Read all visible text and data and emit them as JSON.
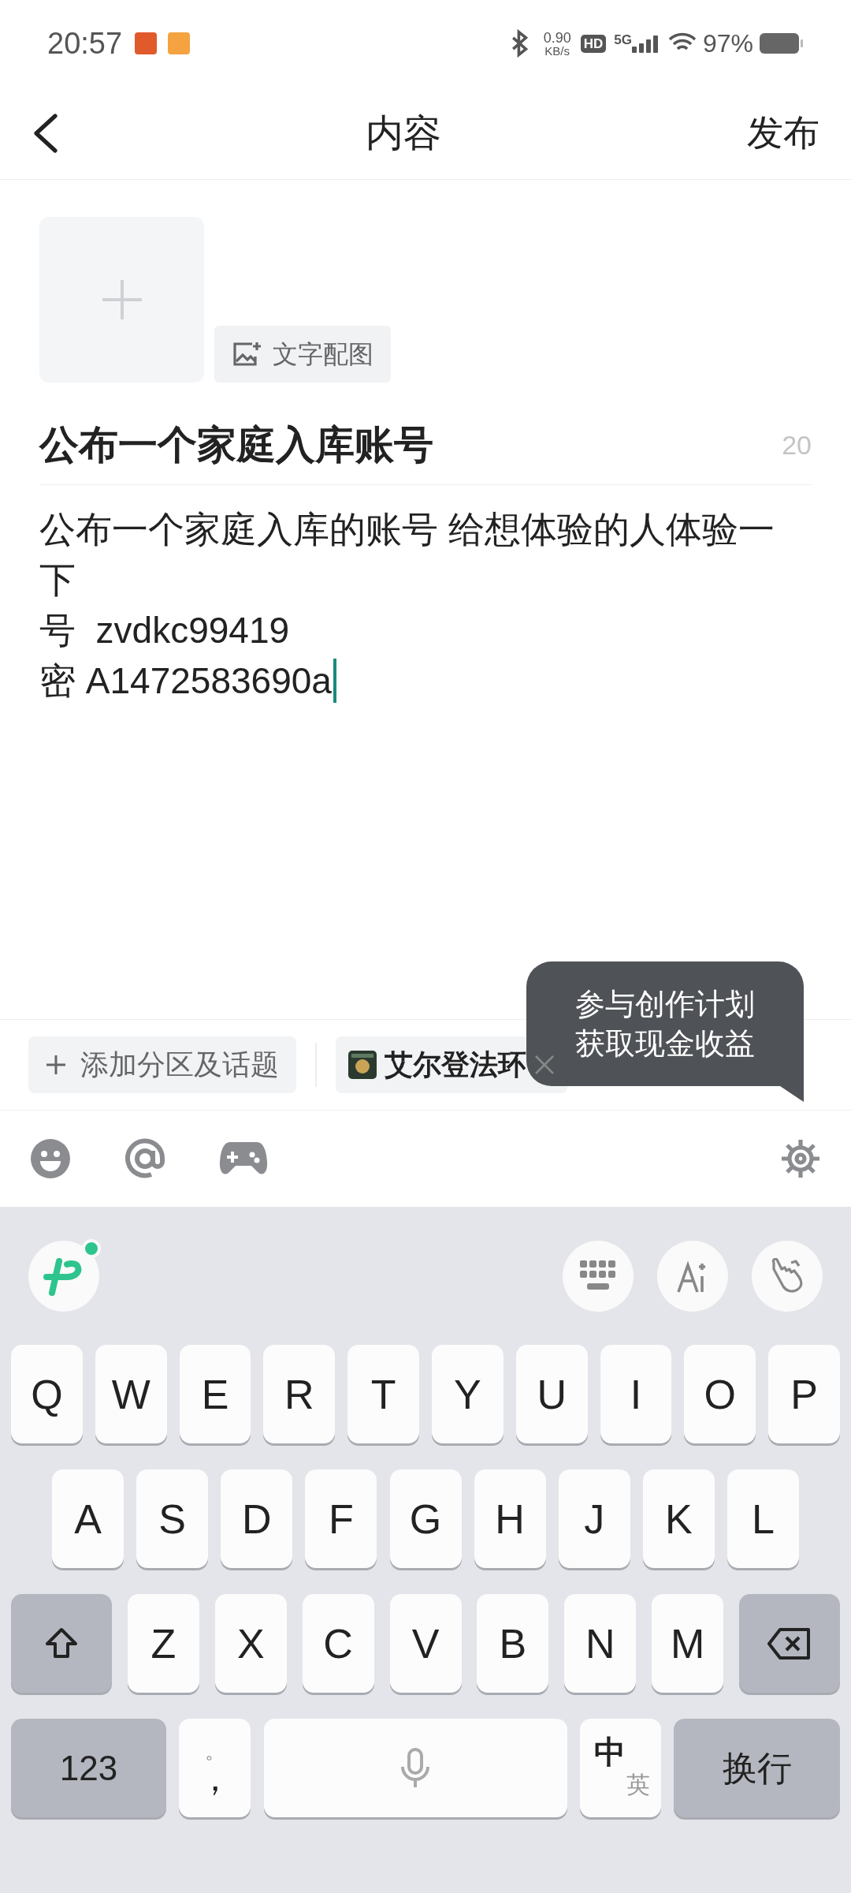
{
  "status_bar": {
    "time": "20:57",
    "speed_value": "0.90",
    "speed_unit": "KB/s",
    "hd": "HD",
    "network": "5G",
    "battery": "97%"
  },
  "header": {
    "title": "内容",
    "action": "发布"
  },
  "editor": {
    "picture_button": "文字配图",
    "title": "公布一个家庭入库账号",
    "char_count": "20",
    "body_lines": [
      "公布一个家庭入库的账号 给想体验的人体验一",
      "下",
      "号  zvdkc99419",
      "密 A1472583690a"
    ]
  },
  "topics": {
    "add_button": "添加分区及话题",
    "chips": [
      {
        "label": "艾尔登法环"
      }
    ]
  },
  "tooltip": {
    "lines": [
      "参与创作计划",
      "获取现金收益"
    ]
  },
  "keyboard": {
    "rows": [
      [
        {
          "kind": "letter",
          "label": "Q"
        },
        {
          "kind": "letter",
          "label": "W"
        },
        {
          "kind": "letter",
          "label": "E"
        },
        {
          "kind": "letter",
          "label": "R"
        },
        {
          "kind": "letter",
          "label": "T"
        },
        {
          "kind": "letter",
          "label": "Y"
        },
        {
          "kind": "letter",
          "label": "U"
        },
        {
          "kind": "letter",
          "label": "I"
        },
        {
          "kind": "letter",
          "label": "O"
        },
        {
          "kind": "letter",
          "label": "P"
        }
      ],
      [
        {
          "kind": "letter",
          "label": "A"
        },
        {
          "kind": "letter",
          "label": "S"
        },
        {
          "kind": "letter",
          "label": "D"
        },
        {
          "kind": "letter",
          "label": "F"
        },
        {
          "kind": "letter",
          "label": "G"
        },
        {
          "kind": "letter",
          "label": "H"
        },
        {
          "kind": "letter",
          "label": "J"
        },
        {
          "kind": "letter",
          "label": "K"
        },
        {
          "kind": "letter",
          "label": "L"
        }
      ],
      [
        {
          "kind": "shift"
        },
        {
          "kind": "letter",
          "label": "Z"
        },
        {
          "kind": "letter",
          "label": "X"
        },
        {
          "kind": "letter",
          "label": "C"
        },
        {
          "kind": "letter",
          "label": "V"
        },
        {
          "kind": "letter",
          "label": "B"
        },
        {
          "kind": "letter",
          "label": "N"
        },
        {
          "kind": "letter",
          "label": "M"
        },
        {
          "kind": "backspace"
        }
      ],
      [
        {
          "kind": "numbers",
          "label": "123"
        },
        {
          "kind": "punct",
          "top": "。",
          "label": "，"
        },
        {
          "kind": "space"
        },
        {
          "kind": "lang",
          "label": "中",
          "sub": "英"
        },
        {
          "kind": "enter",
          "label": "换行"
        }
      ]
    ]
  }
}
